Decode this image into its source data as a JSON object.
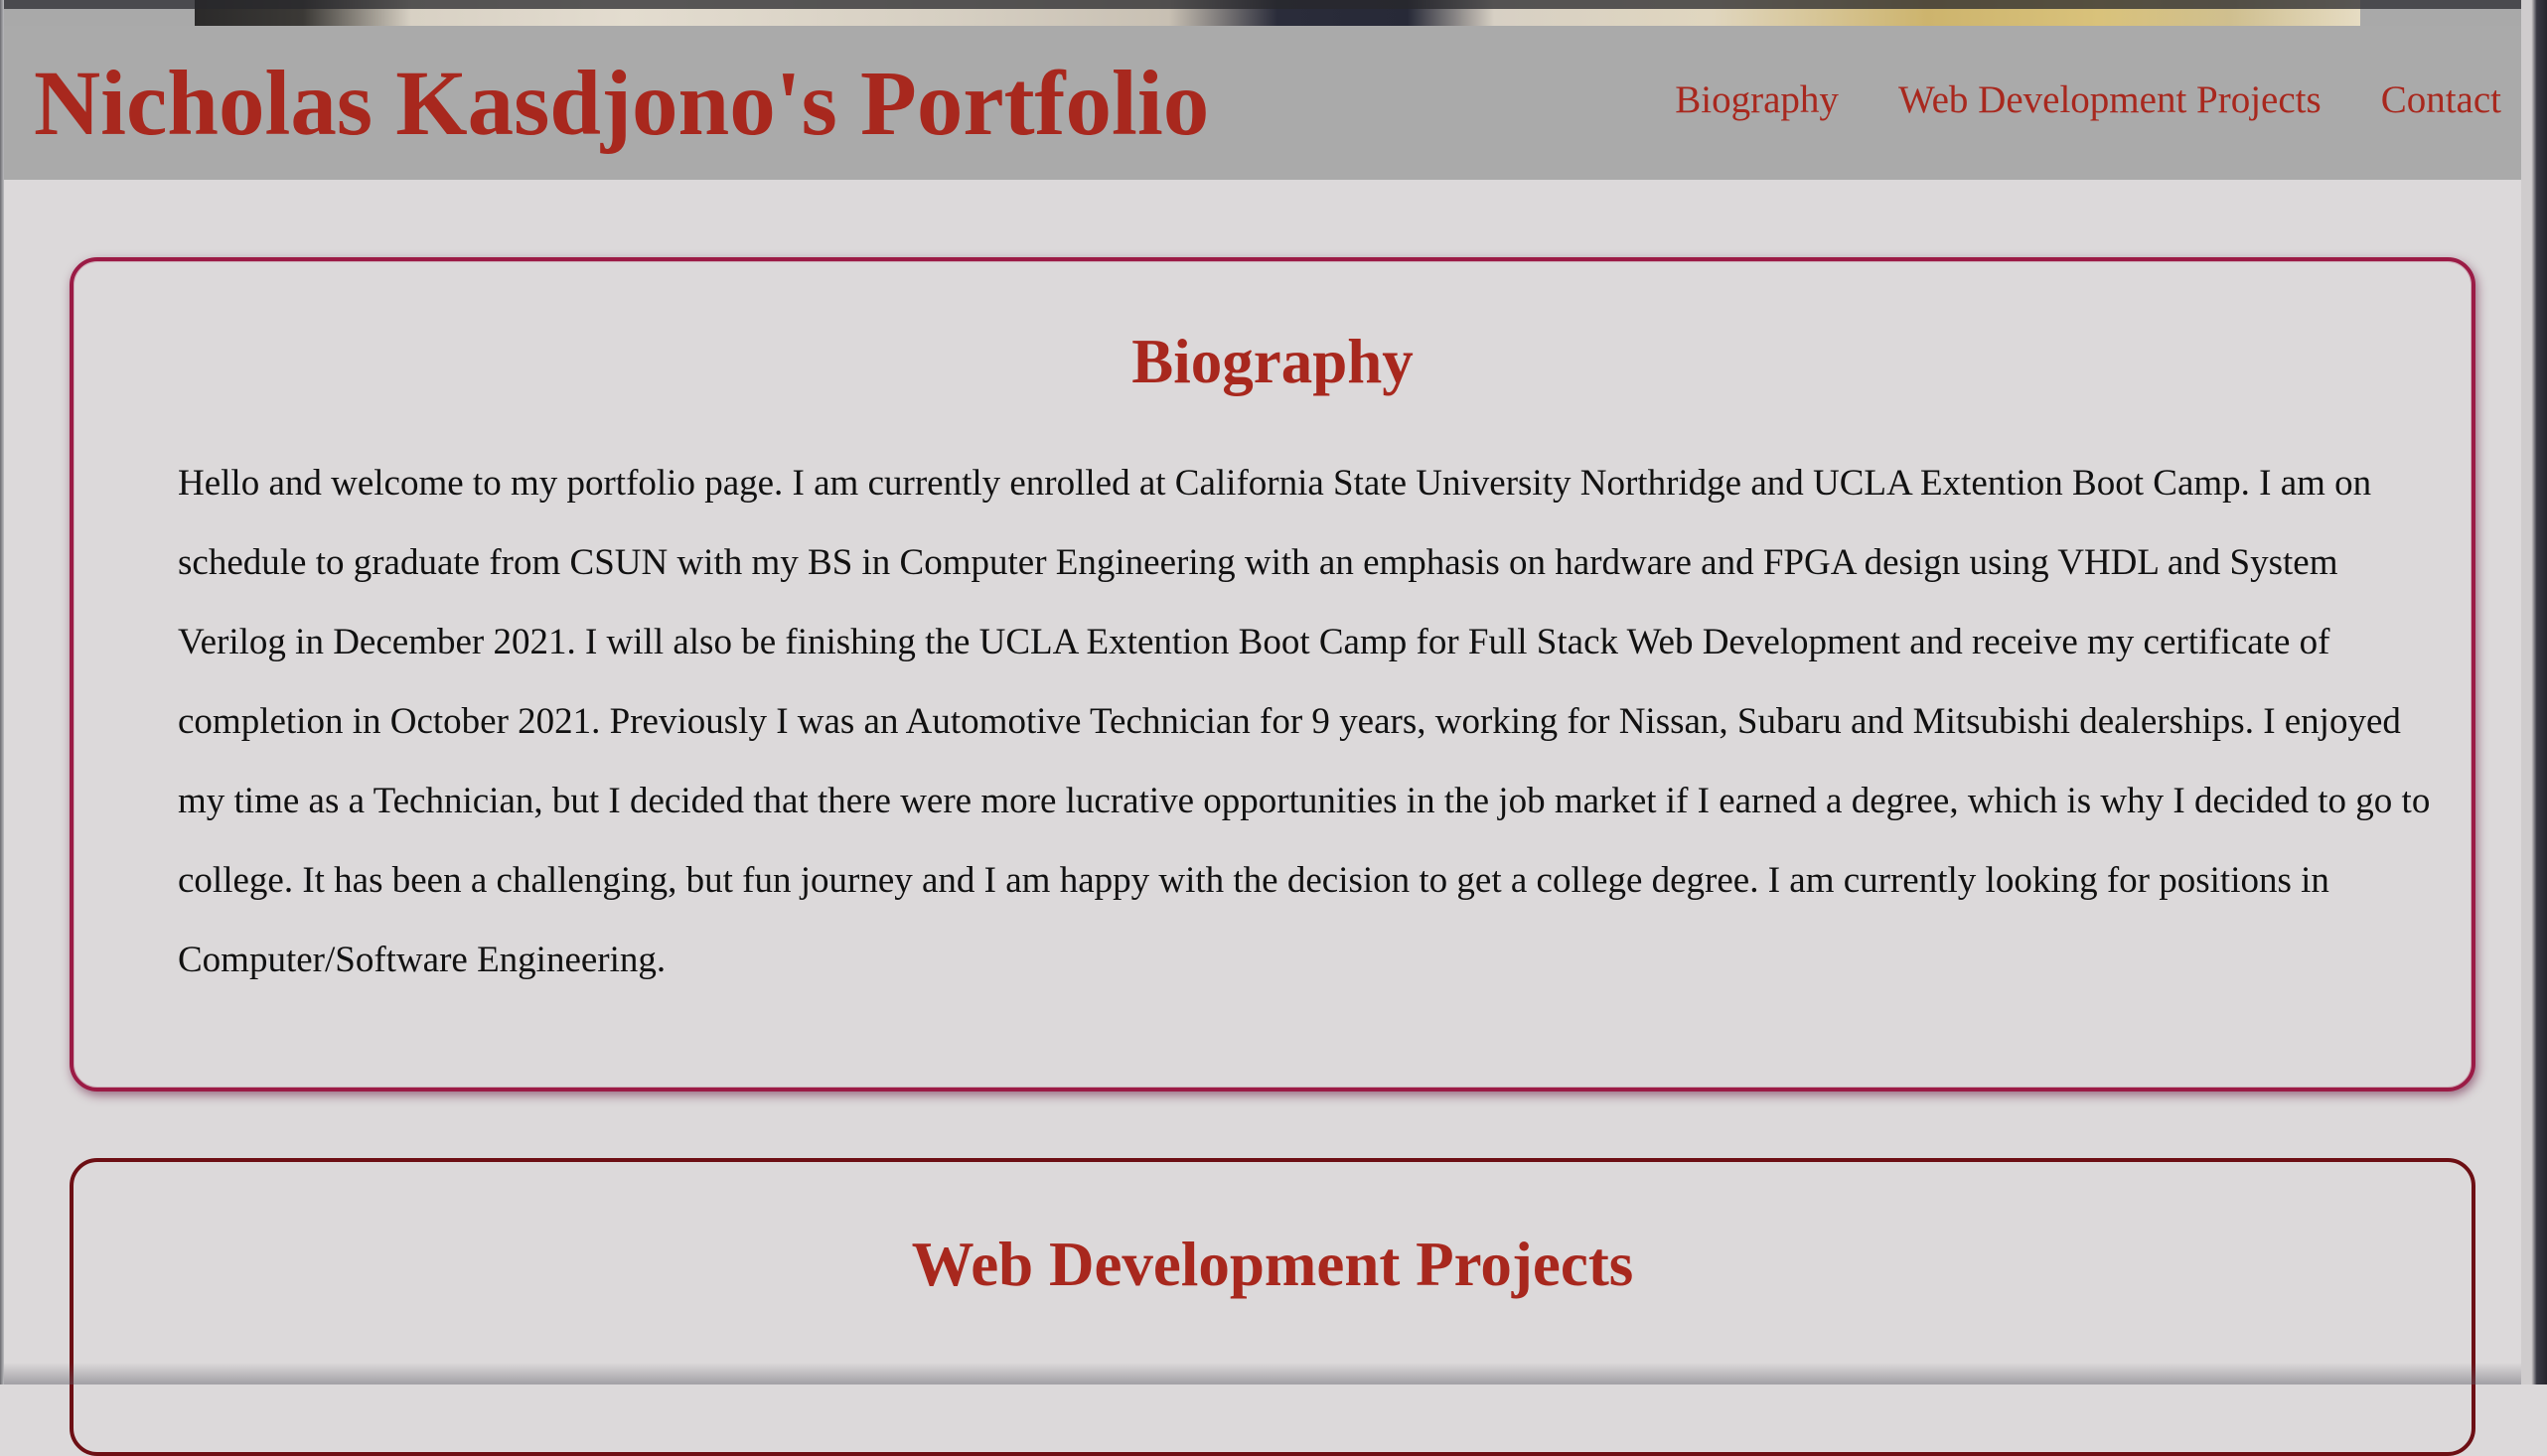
{
  "header": {
    "title": "Nicholas Kasdjono's Portfolio",
    "nav": [
      {
        "label": "Biography"
      },
      {
        "label": "Web Development Projects"
      },
      {
        "label": "Contact"
      }
    ]
  },
  "biography": {
    "heading": "Biography",
    "text": "Hello and welcome to my portfolio page. I am currently enrolled at California State University Northridge and UCLA Extention Boot Camp. I am on schedule to graduate from CSUN with my BS in Computer Engineering with an emphasis on hardware and FPGA design using VHDL and System Verilog in December 2021. I will also be finishing the UCLA Extention Boot Camp for Full Stack Web Development and receive my certificate of completion in October 2021. Previously I was an Automotive Technician for 9 years, working for Nissan, Subaru and Mitsubishi dealerships. I enjoyed my time as a Technician, but I decided that there were more lucrative opportunities in the job market if I earned a degree, which is why I decided to go to college. It has been a challenging, but fun journey and I am happy with the decision to get a college degree. I am currently looking for positions in Computer/Software Engineering."
  },
  "projects": {
    "heading": "Web Development Projects"
  },
  "colors": {
    "accent": "#a8281e",
    "header_bg": "#aaaaaa",
    "page_bg": "#dcd9da",
    "bio_border": "#9b1b45",
    "projects_border": "#6d0f14"
  }
}
